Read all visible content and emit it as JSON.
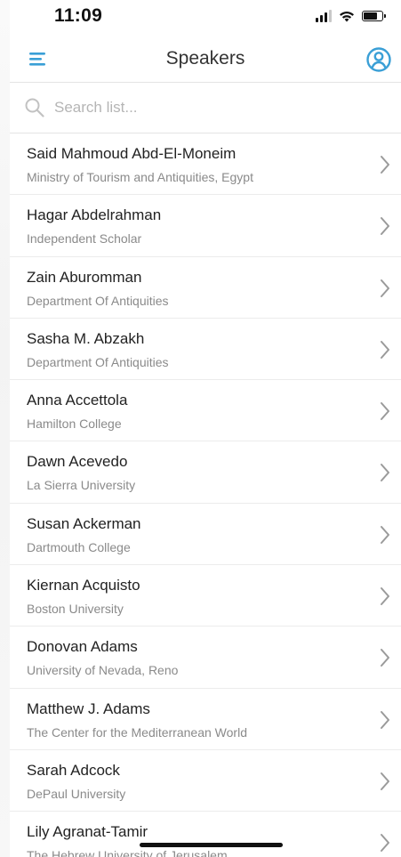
{
  "status": {
    "time": "11:09"
  },
  "header": {
    "title": "Speakers"
  },
  "search": {
    "placeholder": "Search list..."
  },
  "speakers": [
    {
      "name": "Said Mahmoud Abd-El-Moneim",
      "org": "Ministry of Tourism and Antiquities, Egypt"
    },
    {
      "name": "Hagar Abdelrahman",
      "org": "Independent Scholar"
    },
    {
      "name": "Zain Aburomman",
      "org": "Department Of Antiquities"
    },
    {
      "name": "Sasha M. Abzakh",
      "org": "Department Of Antiquities"
    },
    {
      "name": "Anna Accettola",
      "org": "Hamilton College"
    },
    {
      "name": "Dawn Acevedo",
      "org": "La Sierra University"
    },
    {
      "name": "Susan Ackerman",
      "org": "Dartmouth College"
    },
    {
      "name": "Kiernan Acquisto",
      "org": "Boston University"
    },
    {
      "name": "Donovan Adams",
      "org": "University of Nevada, Reno"
    },
    {
      "name": "Matthew J. Adams",
      "org": "The Center for the Mediterranean World"
    },
    {
      "name": "Sarah Adcock",
      "org": "DePaul University"
    },
    {
      "name": "Lily Agranat-Tamir",
      "org": "The Hebrew University of Jerusalem"
    }
  ],
  "colors": {
    "accent": "#3a9fd6",
    "chevron": "#9a9a9a"
  },
  "icons": {
    "menu": "hamburger-icon",
    "profile": "user-circle-icon",
    "search": "search-icon",
    "row": "chevron-right-icon"
  }
}
